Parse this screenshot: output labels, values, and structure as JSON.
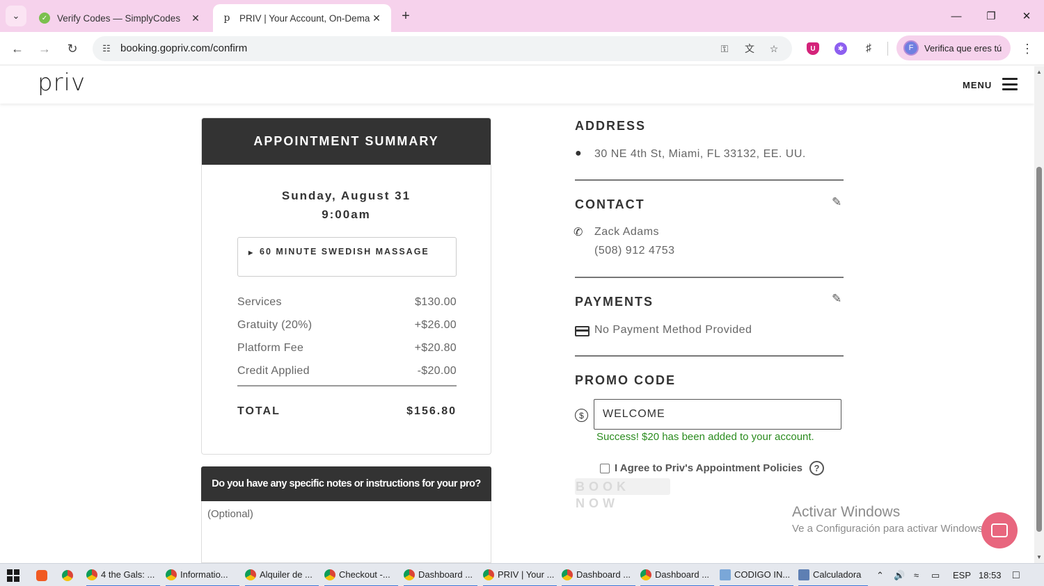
{
  "browser": {
    "tabs": [
      {
        "title": "Verify Codes — SimplyCodes",
        "active": false
      },
      {
        "title": "PRIV | Your Account, On-Demar",
        "active": true
      }
    ],
    "url": "booking.gopriv.com/confirm",
    "profile_label": "Verifica que eres tú",
    "profile_initial": "F"
  },
  "header": {
    "logo": "priv",
    "menu_label": "MENU"
  },
  "summary": {
    "title": "APPOINTMENT SUMMARY",
    "date": "Sunday, August 31",
    "time": "9:00am",
    "service": "60 MINUTE SWEDISH MASSAGE",
    "line_items": [
      {
        "label": "Services",
        "value": "$130.00"
      },
      {
        "label": "Gratuity (20%)",
        "value": "+$26.00"
      },
      {
        "label": "Platform Fee",
        "value": "+$20.80"
      },
      {
        "label": "Credit Applied",
        "value": "-$20.00"
      }
    ],
    "total_label": "TOTAL",
    "total_value": "$156.80"
  },
  "notes": {
    "heading": "Do you have any specific notes or instructions for your pro?",
    "placeholder": "(Optional)"
  },
  "address": {
    "title": "ADDRESS",
    "value": "30 NE 4th St, Miami, FL 33132, EE. UU."
  },
  "contact": {
    "title": "CONTACT",
    "name": "Zack Adams",
    "phone": "(508) 912 4753"
  },
  "payments": {
    "title": "PAYMENTS",
    "value": "No Payment Method Provided"
  },
  "promo": {
    "title": "PROMO CODE",
    "value": "WELCOME",
    "success": "Success! $20 has been added to your account."
  },
  "agree_label": "I Agree to Priv's Appointment Policies",
  "agree_checked": false,
  "book_label": "BOOK NOW",
  "watermark": {
    "line1": "Activar Windows",
    "line2": "Ve a Configuración para activar Windows."
  },
  "taskbar": {
    "items": [
      "4 the Gals: ...",
      "Informatio...",
      "Alquiler de ...",
      "Checkout -...",
      "Dashboard ...",
      "PRIV | Your ...",
      "Dashboard ...",
      "Dashboard ...",
      "CODIGO IN...",
      "Calculadora"
    ],
    "language": "ESP",
    "time": "18:53"
  }
}
